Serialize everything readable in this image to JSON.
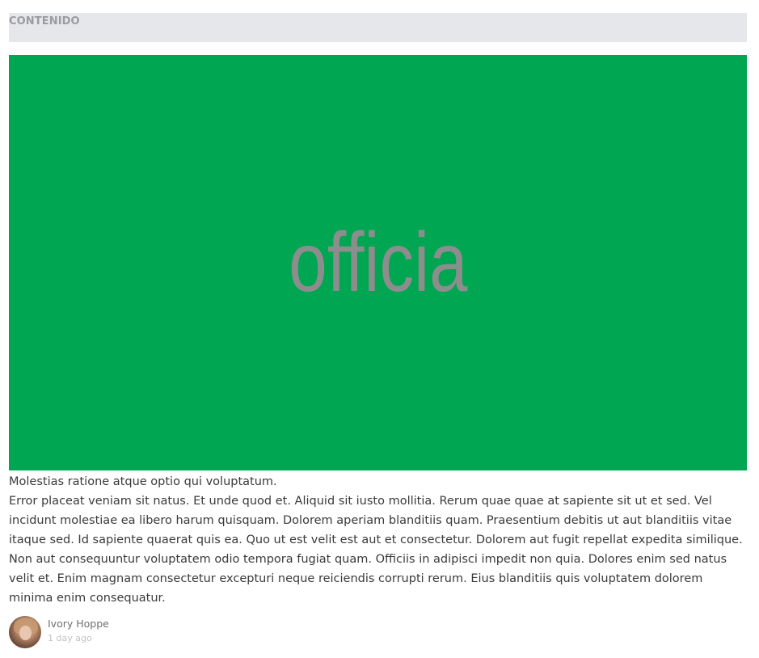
{
  "section": {
    "label": "CONTENIDO"
  },
  "hero": {
    "text": "officia",
    "background_color": "#00a651",
    "text_color": "#8d8d8d"
  },
  "post": {
    "title": "Molestias ratione atque optio qui voluptatum.",
    "body": "Error placeat veniam sit natus. Et unde quod et. Aliquid sit iusto mollitia. Rerum quae quae at sapiente sit ut et sed. Vel incidunt molestiae ea libero harum quisquam. Dolorem aperiam blanditiis quam. Praesentium debitis ut aut blanditiis vitae itaque sed. Id sapiente quaerat quis ea. Quo ut est velit est aut et consectetur. Dolorem aut fugit repellat expedita similique. Non aut consequuntur voluptatem odio tempora fugiat quam. Officiis in adipisci impedit non quia. Dolores enim sed natus velit et. Enim magnam consectetur excepturi neque reiciendis corrupti rerum. Eius blanditiis quis voluptatem dolorem minima enim consequatur."
  },
  "author": {
    "name": "Ivory Hoppe",
    "time": "1 day ago",
    "avatar_icon": "user-avatar-photo"
  },
  "colors": {
    "header_bg": "#e6e7ea",
    "header_text": "#9a9aa3",
    "body_text": "#3a3a3a"
  }
}
